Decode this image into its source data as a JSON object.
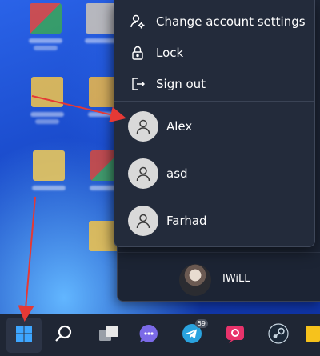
{
  "account_menu": {
    "items": [
      {
        "label": "Change account settings",
        "icon": "user-gear-icon"
      },
      {
        "label": "Lock",
        "icon": "lock-icon"
      },
      {
        "label": "Sign out",
        "icon": "sign-out-icon"
      }
    ],
    "users": [
      {
        "name": "Alex",
        "icon": "user-avatar-icon"
      },
      {
        "name": "asd",
        "icon": "user-avatar-icon"
      },
      {
        "name": "Farhad",
        "icon": "user-avatar-icon"
      }
    ]
  },
  "start_menu": {
    "current_user": "IWiLL"
  },
  "taskbar": {
    "telegram_badge": "59",
    "buttons": [
      "windows-start-icon",
      "search-icon",
      "task-view-icon",
      "chat-icon",
      "telegram-icon",
      "app-pink-icon",
      "steam-icon",
      "app-yellow-icon"
    ]
  },
  "colors": {
    "annotation_arrow": "#e53935",
    "menu_background": "#232b3b",
    "taskbar_background": "#1f2634"
  }
}
